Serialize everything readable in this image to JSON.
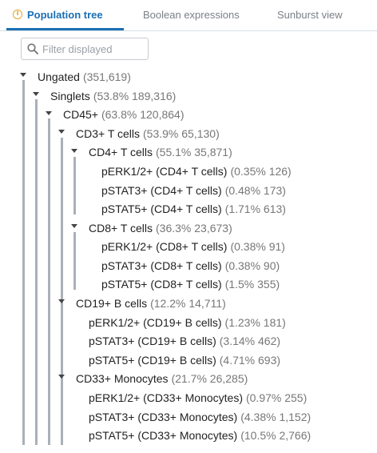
{
  "tabs": [
    {
      "label": "Population tree",
      "active": true
    },
    {
      "label": "Boolean expressions",
      "active": false
    },
    {
      "label": "Sunburst view",
      "active": false
    }
  ],
  "filter": {
    "placeholder": "Filter displayed",
    "value": ""
  },
  "tree": [
    {
      "name": "Ungated",
      "stat": "(351,619)"
    },
    {
      "name": "Singlets",
      "stat": "(53.8%  189,316)"
    },
    {
      "name": "CD45+",
      "stat": "(63.8%  120,864)"
    },
    {
      "name": "CD3+ T cells",
      "stat": "(53.9%  65,130)"
    },
    {
      "name": "CD4+ T cells",
      "stat": "(55.1%  35,871)"
    },
    {
      "name": "pERK1/2+ (CD4+ T cells)",
      "stat": "(0.35%  126)"
    },
    {
      "name": "pSTAT3+ (CD4+ T cells)",
      "stat": "(0.48%  173)"
    },
    {
      "name": "pSTAT5+ (CD4+ T cells)",
      "stat": "(1.71%  613)"
    },
    {
      "name": "CD8+ T cells",
      "stat": "(36.3%  23,673)"
    },
    {
      "name": "pERK1/2+ (CD8+ T cells)",
      "stat": "(0.38%  91)"
    },
    {
      "name": "pSTAT3+ (CD8+ T cells)",
      "stat": "(0.38%  90)"
    },
    {
      "name": "pSTAT5+ (CD8+ T cells)",
      "stat": "(1.5%  355)"
    },
    {
      "name": "CD19+ B cells",
      "stat": "(12.2%  14,711)"
    },
    {
      "name": "pERK1/2+ (CD19+ B cells)",
      "stat": "(1.23%  181)"
    },
    {
      "name": "pSTAT3+ (CD19+ B cells)",
      "stat": "(3.14%  462)"
    },
    {
      "name": "pSTAT5+ (CD19+ B cells)",
      "stat": "(4.71%  693)"
    },
    {
      "name": "CD33+ Monocytes",
      "stat": "(21.7%  26,285)"
    },
    {
      "name": "pERK1/2+ (CD33+ Monocytes)",
      "stat": "(0.97%  255)"
    },
    {
      "name": "pSTAT3+ (CD33+ Monocytes)",
      "stat": "(4.38%  1,152)"
    },
    {
      "name": "pSTAT5+ (CD33+ Monocytes)",
      "stat": "(10.5%  2,766)"
    }
  ],
  "colors": {
    "accent": "#1a6fb5",
    "info": "#e0a62b",
    "tree_line": "#aab0b8"
  },
  "icons": {
    "info": "info-icon",
    "search": "search-icon",
    "toggle": "chevron-down-icon"
  }
}
